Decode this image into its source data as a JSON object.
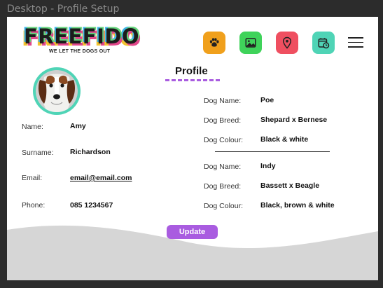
{
  "window": {
    "title": "Desktop - Profile Setup"
  },
  "logo": {
    "word": "FREEFIDO",
    "tagline": "WE LET THE DOGS OUT"
  },
  "nav": [
    {
      "name": "paw-button",
      "icon": "paw-icon",
      "color": "#f0a01c"
    },
    {
      "name": "gallery-button",
      "icon": "image-icon",
      "color": "#3fd35a"
    },
    {
      "name": "map-button",
      "icon": "location-pin-icon",
      "color": "#ef4f60"
    },
    {
      "name": "schedule-button",
      "icon": "calendar-clock-icon",
      "color": "#4fd4b6"
    }
  ],
  "page": {
    "heading": "Profile",
    "accent": "#a95ce0"
  },
  "owner": {
    "name_label": "Name:",
    "name": "Amy",
    "surname_label": "Surname:",
    "surname": "Richardson",
    "email_label": "Email:",
    "email": "email@email.com",
    "phone_label": "Phone:",
    "phone": "085 1234567"
  },
  "dogs": [
    {
      "name_label": "Dog Name:",
      "name": "Poe",
      "breed_label": "Dog Breed:",
      "breed": "Shepard x Bernese",
      "colour_label": "Dog Colour:",
      "colour": "Black & white"
    },
    {
      "name_label": "Dog Name:",
      "name": "Indy",
      "breed_label": "Dog Breed:",
      "breed": "Bassett x Beagle",
      "colour_label": "Dog Colour:",
      "colour": "Black, brown & white"
    }
  ],
  "actions": {
    "update_label": "Update"
  }
}
